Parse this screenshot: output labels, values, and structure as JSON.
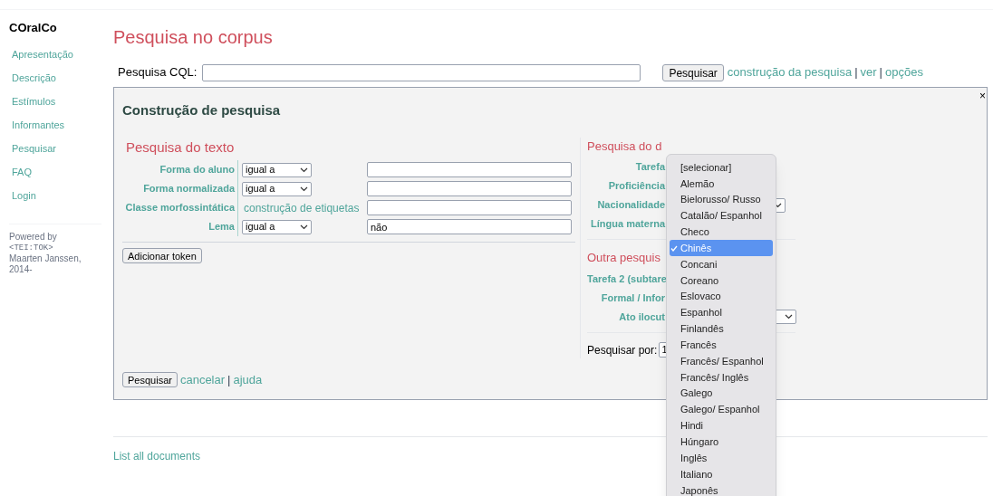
{
  "sidebar": {
    "title": "COralCo",
    "items": [
      {
        "label": "Apresentação"
      },
      {
        "label": "Descrição"
      },
      {
        "label": "Estímulos"
      },
      {
        "label": "Informantes"
      },
      {
        "label": "Pesquisar"
      },
      {
        "label": "FAQ"
      },
      {
        "label": "Login"
      }
    ],
    "credit": [
      {
        "text": "Powered by",
        "kind": "plain"
      },
      {
        "text": "<TEI:TOK>",
        "kind": "code"
      },
      {
        "text": "Maarten Janssen,",
        "kind": "plain"
      },
      {
        "text": "2014-",
        "kind": "plain"
      }
    ]
  },
  "page_title": "Pesquisa no corpus",
  "cql": {
    "label": "Pesquisa CQL:",
    "button": "Pesquisar",
    "links": [
      {
        "text": "construção da pesquisa",
        "kind": "link"
      },
      {
        "text": "|",
        "kind": "separator"
      },
      {
        "text": "ver",
        "kind": "link"
      },
      {
        "text": "|",
        "kind": "separator"
      },
      {
        "text": "opções",
        "kind": "link"
      }
    ]
  },
  "panel": {
    "title": "Construção de pesquisa",
    "close": "×",
    "text_search": {
      "heading": "Pesquisa do texto",
      "rows": [
        {
          "label": "Forma do aluno",
          "kind": "select",
          "operator": "igual a"
        },
        {
          "label": "Forma normalizada",
          "kind": "select",
          "operator": "igual a"
        },
        {
          "label": "Classe morfossintática",
          "kind": "link",
          "link": "construção de etiquetas"
        },
        {
          "label": "Lema",
          "kind": "select",
          "operator": "igual a",
          "value": "não"
        }
      ],
      "add_button": "Adicionar token"
    },
    "doc_search": {
      "heading": "Pesquisa do d",
      "rows": [
        {
          "label": "Tarefa",
          "kind": "hidden"
        },
        {
          "label": "Proficiência",
          "kind": "hidden"
        },
        {
          "label": "Nacionalidade",
          "kind": "select"
        },
        {
          "label": "Língua materna",
          "kind": "hidden"
        }
      ]
    },
    "other_search": {
      "heading": "Outra pesquis",
      "rows": [
        {
          "label": "Tarefa 2 (subtare",
          "kind": "hidden"
        },
        {
          "label": "Formal / Infor",
          "kind": "hidden"
        },
        {
          "label": "Ato ilocut",
          "kind": "select"
        }
      ]
    },
    "search_by": {
      "label": "Pesquisar por:",
      "value": "1"
    },
    "footer": {
      "button": "Pesquisar",
      "links": [
        {
          "text": "cancelar",
          "kind": "link"
        },
        {
          "text": "|",
          "kind": "separator"
        },
        {
          "text": "ajuda",
          "kind": "link"
        }
      ]
    }
  },
  "dropdown": {
    "items": [
      {
        "label": "[selecionar]",
        "selected": false
      },
      {
        "label": "Alemão",
        "selected": false
      },
      {
        "label": "Bielorusso/ Russo",
        "selected": false
      },
      {
        "label": "Catalão/ Espanhol",
        "selected": false
      },
      {
        "label": "Checo",
        "selected": false
      },
      {
        "label": "Chinês",
        "selected": true
      },
      {
        "label": "Concani",
        "selected": false
      },
      {
        "label": "Coreano",
        "selected": false
      },
      {
        "label": "Eslovaco",
        "selected": false
      },
      {
        "label": "Espanhol",
        "selected": false
      },
      {
        "label": "Finlandês",
        "selected": false
      },
      {
        "label": "Francês",
        "selected": false
      },
      {
        "label": "Francês/ Espanhol",
        "selected": false
      },
      {
        "label": "Francês/ Inglês",
        "selected": false
      },
      {
        "label": "Galego",
        "selected": false
      },
      {
        "label": "Galego/ Espanhol",
        "selected": false
      },
      {
        "label": "Hindi",
        "selected": false
      },
      {
        "label": "Húngaro",
        "selected": false
      },
      {
        "label": "Inglês",
        "selected": false
      },
      {
        "label": "Italiano",
        "selected": false
      },
      {
        "label": "Japonês",
        "selected": false
      }
    ]
  },
  "footer_link": "List all documents"
}
